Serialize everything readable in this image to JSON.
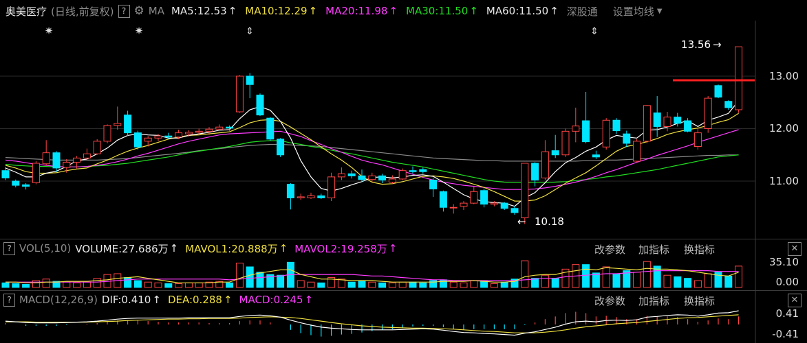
{
  "header": {
    "stock_name": "奥美医疗",
    "period_label": "(日线,前复权)",
    "help_label": "?",
    "ma_label": "MA",
    "ma5": "MA5:12.53",
    "ma10": "MA10:12.29",
    "ma20": "MA20:11.98",
    "ma30": "MA30:11.50",
    "ma60": "MA60:11.50",
    "arrow": "↑",
    "connect_label": "深股通",
    "settings_label": "设置均线"
  },
  "price_axis": {
    "labels": [
      "13.00",
      "12.00",
      "11.00"
    ]
  },
  "annotations": {
    "high": "13.56",
    "low": "10.18"
  },
  "volume_panel": {
    "help_label": "?",
    "title": "VOL(5,10)",
    "volume": "VOLUME:27.686万",
    "mavol1": "MAVOL1:20.888万",
    "mavol2": "MAVOL2:19.258万",
    "arrow": "↑",
    "axis": [
      "35.10",
      "0.00"
    ],
    "btn_params": "改参数",
    "btn_add": "加指标",
    "btn_switch": "换指标",
    "close": "✕"
  },
  "macd_panel": {
    "help_label": "?",
    "title": "MACD(12,26,9)",
    "dif": "DIF:0.410",
    "dea": "DEA:0.288",
    "macd": "MACD:0.245",
    "arrow": "↑",
    "axis": [
      "0.41",
      "-0.41"
    ],
    "btn_params": "改参数",
    "btn_add": "加指标",
    "btn_switch": "换指标",
    "close": "✕"
  },
  "colors": {
    "up": "#ff4444",
    "down": "#00e5ff",
    "ma5": "#ffffff",
    "ma10": "#f0e040",
    "ma20": "#ff3cff",
    "ma30": "#22dd22",
    "ma60": "#8a8a8a",
    "resistance": "#ff2020"
  },
  "chart_data": {
    "type": "candlestick",
    "candles": [
      {
        "o": 11.2,
        "h": 11.27,
        "l": 11.02,
        "c": 11.06
      },
      {
        "o": 11.0,
        "h": 11.03,
        "l": 10.88,
        "c": 10.92
      },
      {
        "o": 10.93,
        "h": 10.96,
        "l": 10.84,
        "c": 10.9
      },
      {
        "o": 10.97,
        "h": 11.38,
        "l": 10.94,
        "c": 11.34
      },
      {
        "o": 11.33,
        "h": 11.78,
        "l": 11.3,
        "c": 11.54
      },
      {
        "o": 11.54,
        "h": 11.57,
        "l": 11.17,
        "c": 11.25
      },
      {
        "o": 11.26,
        "h": 11.42,
        "l": 11.16,
        "c": 11.36
      },
      {
        "o": 11.36,
        "h": 11.48,
        "l": 11.24,
        "c": 11.44
      },
      {
        "o": 11.44,
        "h": 11.62,
        "l": 11.4,
        "c": 11.52
      },
      {
        "o": 11.52,
        "h": 11.8,
        "l": 11.5,
        "c": 11.76
      },
      {
        "o": 11.76,
        "h": 12.08,
        "l": 11.72,
        "c": 12.06
      },
      {
        "o": 12.06,
        "h": 12.42,
        "l": 11.98,
        "c": 12.1
      },
      {
        "o": 12.26,
        "h": 12.34,
        "l": 11.86,
        "c": 11.92
      },
      {
        "o": 11.92,
        "h": 11.96,
        "l": 11.6,
        "c": 11.65
      },
      {
        "o": 11.76,
        "h": 11.86,
        "l": 11.66,
        "c": 11.82
      },
      {
        "o": 11.82,
        "h": 11.9,
        "l": 11.76,
        "c": 11.86
      },
      {
        "o": 11.86,
        "h": 11.92,
        "l": 11.8,
        "c": 11.84
      },
      {
        "o": 11.84,
        "h": 11.98,
        "l": 11.8,
        "c": 11.92
      },
      {
        "o": 11.9,
        "h": 11.97,
        "l": 11.85,
        "c": 11.93
      },
      {
        "o": 11.93,
        "h": 12.0,
        "l": 11.88,
        "c": 11.95
      },
      {
        "o": 11.95,
        "h": 12.03,
        "l": 11.88,
        "c": 11.99
      },
      {
        "o": 11.99,
        "h": 12.08,
        "l": 11.95,
        "c": 12.03
      },
      {
        "o": 12.03,
        "h": 12.06,
        "l": 11.96,
        "c": 12.01
      },
      {
        "o": 12.32,
        "h": 13.02,
        "l": 12.3,
        "c": 13.0
      },
      {
        "o": 13.0,
        "h": 13.06,
        "l": 12.58,
        "c": 12.84
      },
      {
        "o": 12.64,
        "h": 12.67,
        "l": 12.24,
        "c": 12.26
      },
      {
        "o": 12.2,
        "h": 12.22,
        "l": 11.77,
        "c": 11.8
      },
      {
        "o": 11.8,
        "h": 11.82,
        "l": 11.46,
        "c": 11.5
      },
      {
        "o": 10.94,
        "h": 10.96,
        "l": 10.46,
        "c": 10.68
      },
      {
        "o": 10.68,
        "h": 10.76,
        "l": 10.64,
        "c": 10.7
      },
      {
        "o": 10.68,
        "h": 10.78,
        "l": 10.66,
        "c": 10.72
      },
      {
        "o": 10.72,
        "h": 10.76,
        "l": 10.66,
        "c": 10.68
      },
      {
        "o": 10.68,
        "h": 11.16,
        "l": 10.62,
        "c": 11.08
      },
      {
        "o": 11.08,
        "h": 11.26,
        "l": 11.02,
        "c": 11.14
      },
      {
        "o": 11.14,
        "h": 11.2,
        "l": 11.05,
        "c": 11.1
      },
      {
        "o": 11.1,
        "h": 11.22,
        "l": 10.98,
        "c": 11.03
      },
      {
        "o": 11.03,
        "h": 11.16,
        "l": 10.98,
        "c": 11.1
      },
      {
        "o": 11.1,
        "h": 11.14,
        "l": 10.96,
        "c": 11.02
      },
      {
        "o": 10.98,
        "h": 11.11,
        "l": 10.95,
        "c": 11.04
      },
      {
        "o": 11.04,
        "h": 11.24,
        "l": 11.02,
        "c": 11.2
      },
      {
        "o": 11.2,
        "h": 11.28,
        "l": 11.14,
        "c": 11.18
      },
      {
        "o": 11.22,
        "h": 11.26,
        "l": 11.14,
        "c": 11.18
      },
      {
        "o": 11.02,
        "h": 11.06,
        "l": 10.7,
        "c": 10.85
      },
      {
        "o": 10.8,
        "h": 10.82,
        "l": 10.42,
        "c": 10.5
      },
      {
        "o": 10.5,
        "h": 10.56,
        "l": 10.38,
        "c": 10.5
      },
      {
        "o": 10.52,
        "h": 10.62,
        "l": 10.45,
        "c": 10.58
      },
      {
        "o": 10.58,
        "h": 10.9,
        "l": 10.56,
        "c": 10.8
      },
      {
        "o": 10.82,
        "h": 10.86,
        "l": 10.5,
        "c": 10.56
      },
      {
        "o": 10.56,
        "h": 10.62,
        "l": 10.52,
        "c": 10.58
      },
      {
        "o": 10.58,
        "h": 10.6,
        "l": 10.45,
        "c": 10.48
      },
      {
        "o": 10.48,
        "h": 10.53,
        "l": 10.36,
        "c": 10.4
      },
      {
        "o": 10.3,
        "h": 11.34,
        "l": 10.18,
        "c": 11.34
      },
      {
        "o": 11.34,
        "h": 11.36,
        "l": 10.9,
        "c": 11.02
      },
      {
        "o": 11.06,
        "h": 11.78,
        "l": 11.02,
        "c": 11.56
      },
      {
        "o": 11.58,
        "h": 11.88,
        "l": 11.44,
        "c": 11.5
      },
      {
        "o": 11.5,
        "h": 12.0,
        "l": 11.46,
        "c": 11.95
      },
      {
        "o": 11.95,
        "h": 12.4,
        "l": 11.74,
        "c": 12.05
      },
      {
        "o": 12.15,
        "h": 12.7,
        "l": 11.72,
        "c": 11.75
      },
      {
        "o": 11.5,
        "h": 11.58,
        "l": 11.42,
        "c": 11.46
      },
      {
        "o": 11.65,
        "h": 12.2,
        "l": 11.6,
        "c": 12.16
      },
      {
        "o": 12.16,
        "h": 12.2,
        "l": 11.9,
        "c": 11.96
      },
      {
        "o": 11.9,
        "h": 11.96,
        "l": 11.65,
        "c": 11.72
      },
      {
        "o": 11.38,
        "h": 11.8,
        "l": 11.36,
        "c": 11.76
      },
      {
        "o": 11.76,
        "h": 12.45,
        "l": 11.72,
        "c": 12.44
      },
      {
        "o": 12.3,
        "h": 12.62,
        "l": 11.84,
        "c": 12.04
      },
      {
        "o": 12.04,
        "h": 12.32,
        "l": 11.95,
        "c": 12.22
      },
      {
        "o": 12.22,
        "h": 12.3,
        "l": 12.04,
        "c": 12.1
      },
      {
        "o": 12.15,
        "h": 12.2,
        "l": 11.93,
        "c": 11.95
      },
      {
        "o": 11.66,
        "h": 12.01,
        "l": 11.6,
        "c": 11.92
      },
      {
        "o": 12.0,
        "h": 12.62,
        "l": 11.92,
        "c": 12.58
      },
      {
        "o": 12.82,
        "h": 12.84,
        "l": 12.58,
        "c": 12.6
      },
      {
        "o": 12.52,
        "h": 12.54,
        "l": 12.36,
        "c": 12.4
      },
      {
        "o": 12.36,
        "h": 13.56,
        "l": 12.3,
        "c": 13.56
      }
    ],
    "ma5": [
      11.25,
      11.17,
      11.08,
      11.08,
      11.15,
      11.19,
      11.28,
      11.39,
      11.42,
      11.52,
      11.63,
      11.78,
      11.87,
      11.9,
      11.88,
      11.87,
      11.82,
      11.82,
      11.87,
      11.9,
      11.93,
      11.97,
      11.98,
      12.19,
      12.36,
      12.42,
      12.35,
      12.14,
      11.82,
      11.39,
      11.08,
      10.86,
      10.81,
      10.86,
      10.93,
      10.99,
      11.07,
      11.08,
      11.06,
      11.08,
      11.11,
      11.12,
      11.09,
      10.98,
      10.86,
      10.74,
      10.66,
      10.61,
      10.59,
      10.58,
      10.52,
      10.68,
      10.78,
      10.97,
      11.18,
      11.35,
      11.45,
      11.57,
      11.65,
      11.78,
      11.87,
      11.84,
      11.82,
      11.97,
      11.98,
      12.03,
      12.1,
      12.15,
      12.04,
      12.16,
      12.22,
      12.29,
      12.53
    ],
    "ma10": [
      11.3,
      11.25,
      11.18,
      11.15,
      11.15,
      11.16,
      11.2,
      11.23,
      11.25,
      11.33,
      11.4,
      11.49,
      11.57,
      11.63,
      11.68,
      11.74,
      11.8,
      11.84,
      11.87,
      11.88,
      11.9,
      11.92,
      11.94,
      12.02,
      12.11,
      12.16,
      12.17,
      12.14,
      12.03,
      11.91,
      11.79,
      11.65,
      11.52,
      11.4,
      11.26,
      11.09,
      10.98,
      10.94,
      10.95,
      10.99,
      11.04,
      11.09,
      11.1,
      11.08,
      11.05,
      11.0,
      10.94,
      10.88,
      10.8,
      10.71,
      10.62,
      10.62,
      10.64,
      10.72,
      10.84,
      10.96,
      11.06,
      11.16,
      11.29,
      11.43,
      11.57,
      11.66,
      11.7,
      11.75,
      11.81,
      11.89,
      11.94,
      11.98,
      12.01,
      12.06,
      12.12,
      12.17,
      12.29
    ],
    "ma20": [
      11.4,
      11.38,
      11.35,
      11.32,
      11.3,
      11.28,
      11.27,
      11.27,
      11.28,
      11.3,
      11.33,
      11.37,
      11.42,
      11.48,
      11.53,
      11.59,
      11.65,
      11.71,
      11.76,
      11.8,
      11.84,
      11.88,
      11.9,
      11.91,
      11.92,
      11.93,
      11.94,
      11.95,
      11.9,
      11.85,
      11.77,
      11.7,
      11.62,
      11.55,
      11.47,
      11.4,
      11.35,
      11.31,
      11.25,
      11.19,
      11.13,
      11.07,
      11.02,
      10.98,
      10.95,
      10.92,
      10.9,
      10.88,
      10.86,
      10.84,
      10.84,
      10.84,
      10.85,
      10.87,
      10.9,
      10.94,
      10.98,
      11.03,
      11.09,
      11.16,
      11.22,
      11.29,
      11.36,
      11.42,
      11.49,
      11.55,
      11.61,
      11.67,
      11.74,
      11.8,
      11.86,
      11.92,
      11.98
    ],
    "ma30": [
      11.32,
      11.3,
      11.29,
      11.28,
      11.28,
      11.27,
      11.27,
      11.27,
      11.28,
      11.29,
      11.3,
      11.32,
      11.34,
      11.37,
      11.4,
      11.43,
      11.46,
      11.5,
      11.54,
      11.57,
      11.6,
      11.63,
      11.66,
      11.7,
      11.74,
      11.76,
      11.77,
      11.77,
      11.73,
      11.7,
      11.66,
      11.63,
      11.59,
      11.55,
      11.52,
      11.48,
      11.44,
      11.4,
      11.36,
      11.33,
      11.3,
      11.27,
      11.23,
      11.19,
      11.15,
      11.11,
      11.07,
      11.03,
      11.0,
      10.98,
      10.97,
      10.97,
      10.97,
      10.97,
      10.98,
      10.99,
      11.01,
      11.03,
      11.05,
      11.08,
      11.1,
      11.13,
      11.16,
      11.19,
      11.22,
      11.26,
      11.3,
      11.34,
      11.38,
      11.42,
      11.46,
      11.48,
      11.5
    ],
    "ma60": [
      11.45,
      11.44,
      11.43,
      11.42,
      11.41,
      11.4,
      11.4,
      11.4,
      11.4,
      11.4,
      11.41,
      11.42,
      11.43,
      11.45,
      11.47,
      11.49,
      11.51,
      11.53,
      11.55,
      11.58,
      11.6,
      11.62,
      11.64,
      11.66,
      11.68,
      11.69,
      11.7,
      11.7,
      11.69,
      11.68,
      11.67,
      11.66,
      11.64,
      11.62,
      11.6,
      11.58,
      11.56,
      11.54,
      11.52,
      11.5,
      11.48,
      11.46,
      11.44,
      11.43,
      11.42,
      11.41,
      11.4,
      11.39,
      11.39,
      11.38,
      11.38,
      11.38,
      11.38,
      11.38,
      11.38,
      11.38,
      11.38,
      11.39,
      11.39,
      11.4,
      11.4,
      11.41,
      11.42,
      11.43,
      11.44,
      11.45,
      11.46,
      11.47,
      11.48,
      11.49,
      11.49,
      11.5,
      11.5
    ],
    "resistance_level": 12.9,
    "volume": [
      6,
      5,
      4,
      9,
      11,
      8,
      7,
      6,
      7,
      12,
      17,
      18,
      13,
      9,
      7,
      6,
      5,
      5,
      6,
      6,
      7,
      8,
      6,
      32,
      27,
      20,
      17,
      16,
      33,
      9,
      7,
      6,
      13,
      11,
      7,
      8,
      7,
      6,
      6,
      7,
      7,
      6,
      9,
      10,
      7,
      6,
      9,
      8,
      5,
      7,
      11,
      35,
      12,
      16,
      12,
      24,
      30,
      30,
      19,
      27,
      18,
      22,
      20,
      34,
      28,
      16,
      14,
      12,
      9,
      18,
      20,
      15,
      28
    ],
    "mavol1": [
      7,
      7,
      6,
      6,
      7,
      7,
      8,
      8,
      8,
      9,
      10,
      12,
      13,
      14,
      12,
      10,
      8,
      6,
      6,
      6,
      6,
      7,
      7,
      12,
      16,
      19,
      21,
      23,
      23,
      17,
      14,
      11,
      11,
      10,
      9,
      9,
      9,
      8,
      7,
      7,
      7,
      7,
      7,
      8,
      8,
      8,
      9,
      8,
      7,
      7,
      8,
      14,
      16,
      17,
      17,
      20,
      22,
      24,
      23,
      26,
      25,
      24,
      23,
      25,
      24,
      24,
      23,
      22,
      20,
      18,
      16,
      15,
      20
    ],
    "mavol2": [
      7,
      7,
      7,
      7,
      7,
      7,
      7,
      7,
      7,
      7,
      8,
      9,
      10,
      11,
      11,
      11,
      11,
      11,
      11,
      11,
      11,
      11,
      10,
      11,
      12,
      13,
      14,
      15,
      17,
      17,
      17,
      17,
      17,
      17,
      17,
      16,
      15,
      15,
      14,
      13,
      12,
      11,
      10,
      10,
      9,
      9,
      9,
      9,
      9,
      9,
      9,
      10,
      11,
      12,
      12,
      14,
      15,
      16,
      17,
      18,
      18,
      19,
      20,
      21,
      22,
      22,
      22,
      22,
      22,
      22,
      21,
      21,
      21
    ],
    "dif": [
      0.1,
      0.08,
      0.06,
      0.05,
      0.05,
      0.05,
      0.06,
      0.07,
      0.08,
      0.1,
      0.13,
      0.16,
      0.18,
      0.19,
      0.19,
      0.19,
      0.19,
      0.19,
      0.2,
      0.2,
      0.2,
      0.2,
      0.2,
      0.24,
      0.27,
      0.28,
      0.26,
      0.22,
      0.13,
      0.05,
      -0.02,
      -0.08,
      -0.11,
      -0.13,
      -0.15,
      -0.16,
      -0.16,
      -0.16,
      -0.16,
      -0.15,
      -0.14,
      -0.13,
      -0.14,
      -0.17,
      -0.21,
      -0.24,
      -0.25,
      -0.27,
      -0.28,
      -0.3,
      -0.32,
      -0.26,
      -0.22,
      -0.15,
      -0.08,
      0.01,
      0.08,
      0.1,
      0.08,
      0.12,
      0.13,
      0.12,
      0.14,
      0.22,
      0.24,
      0.27,
      0.29,
      0.28,
      0.25,
      0.29,
      0.34,
      0.35,
      0.41
    ],
    "dea": [
      0.08,
      0.08,
      0.08,
      0.07,
      0.07,
      0.07,
      0.07,
      0.07,
      0.07,
      0.08,
      0.09,
      0.1,
      0.12,
      0.13,
      0.14,
      0.15,
      0.16,
      0.16,
      0.17,
      0.17,
      0.18,
      0.18,
      0.18,
      0.19,
      0.21,
      0.22,
      0.23,
      0.22,
      0.21,
      0.18,
      0.14,
      0.1,
      0.06,
      0.02,
      -0.01,
      -0.04,
      -0.06,
      -0.08,
      -0.09,
      -0.1,
      -0.11,
      -0.11,
      -0.12,
      -0.13,
      -0.14,
      -0.16,
      -0.18,
      -0.2,
      -0.21,
      -0.23,
      -0.25,
      -0.25,
      -0.25,
      -0.23,
      -0.2,
      -0.16,
      -0.11,
      -0.07,
      -0.04,
      -0.01,
      0.02,
      0.04,
      0.06,
      0.09,
      0.12,
      0.15,
      0.18,
      0.2,
      0.21,
      0.23,
      0.25,
      0.27,
      0.29
    ]
  }
}
